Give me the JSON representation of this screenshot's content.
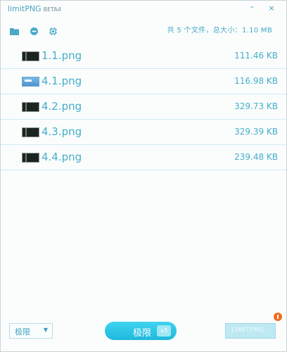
{
  "app": {
    "title": "limitPNG",
    "version": "BETA4"
  },
  "window_controls": {
    "minimize": "–",
    "close": "×"
  },
  "toolbar": {
    "icons": [
      "folder-icon",
      "minus-circle-icon",
      "chip-icon"
    ],
    "summary": "共 5 个文件，总大小：1.10 MB"
  },
  "files": [
    {
      "name": "1.1.png",
      "size": "111.46 KB",
      "thumb": "dark"
    },
    {
      "name": "4.1.png",
      "size": "116.98 KB",
      "thumb": "blue"
    },
    {
      "name": "4.2.png",
      "size": "329.73 KB",
      "thumb": "dark"
    },
    {
      "name": "4.3.png",
      "size": "329.39 KB",
      "thumb": "dark"
    },
    {
      "name": "4.4.png",
      "size": "239.48 KB",
      "thumb": "dark"
    }
  ],
  "footer": {
    "mode_select": {
      "value": "极限"
    },
    "start_button": {
      "label": "极限",
      "badge": "v3"
    },
    "done_button": {
      "label": "LIMITPNG"
    }
  },
  "colors": {
    "accent": "#44adc9",
    "button": "#1fb9de",
    "notify": "#f26b1e"
  }
}
